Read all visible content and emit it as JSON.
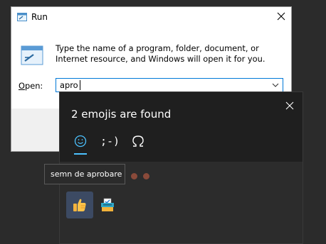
{
  "run_dialog": {
    "title": "Run",
    "description": "Type the name of a program, folder, document, or Internet resource, and Windows will open it for you.",
    "open_label": "Open:",
    "open_label_accel": "O",
    "open_label_rest": "pen:",
    "input_value": "apro"
  },
  "emoji_panel": {
    "results_text": "2 emojis are found",
    "tabs": [
      {
        "name": "emoji",
        "icon": "smiley-icon"
      },
      {
        "name": "kaomoji",
        "label": ";-)"
      },
      {
        "name": "symbols",
        "icon": "omega-icon"
      }
    ],
    "active_tab": "emoji",
    "results": [
      {
        "icon": "thumbs-up-emoji",
        "selected": true
      },
      {
        "icon": "ballot-box-with-ballot-emoji",
        "selected": false
      }
    ],
    "tooltip": "semn de aprobare"
  },
  "colors": {
    "accent": "#0078d7",
    "tab_underline": "#4cc2ff",
    "panel_bg": "#2c2c2c",
    "header_bg": "#1f1f1f"
  }
}
